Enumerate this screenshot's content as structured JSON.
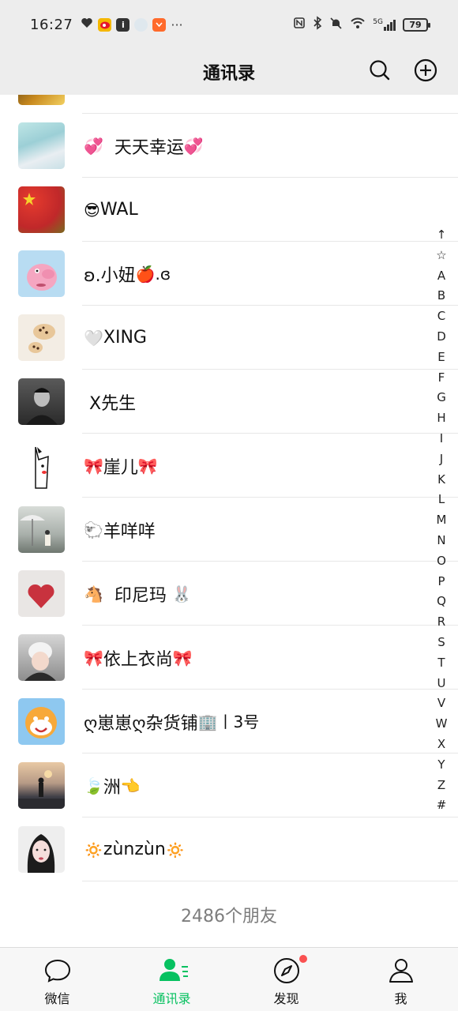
{
  "status": {
    "time": "16:27",
    "battery": "79",
    "net_label": "5G"
  },
  "header": {
    "title": "通讯录"
  },
  "contacts": [
    {
      "name": "天天幸运",
      "prefix_emoji": "💞",
      "suffix_emoji": "💞"
    },
    {
      "name": "WAL",
      "prefix_emoji": "😎",
      "suffix_emoji": ""
    },
    {
      "name": "ʚ.小妞",
      "prefix_emoji": "",
      "suffix_emoji": "🍎.ɞ"
    },
    {
      "name": "XING",
      "prefix_emoji": "🤍",
      "suffix_emoji": ""
    },
    {
      "name": "X先生",
      "prefix_emoji": "",
      "suffix_emoji": ""
    },
    {
      "name": "崖儿",
      "prefix_emoji": "🎀",
      "suffix_emoji": "🎀"
    },
    {
      "name": "羊咩咩",
      "prefix_emoji": "🐑",
      "suffix_emoji": ""
    },
    {
      "name": "印尼玛",
      "prefix_emoji": "🐴",
      "suffix_emoji": "🐰"
    },
    {
      "name": "依上衣尚",
      "prefix_emoji": "🎀",
      "suffix_emoji": "🎀"
    },
    {
      "name": "ღ崽崽ღ杂货铺",
      "prefix_emoji": "",
      "suffix_emoji": "🏢丨3号"
    },
    {
      "name": "洲",
      "prefix_emoji": "🍃",
      "suffix_emoji": "👈"
    },
    {
      "name": "zùnzùn",
      "prefix_emoji": "🔅",
      "suffix_emoji": "🔅"
    }
  ],
  "friend_count": "2486个朋友",
  "index_letters": [
    "↑",
    "☆",
    "A",
    "B",
    "C",
    "D",
    "E",
    "F",
    "G",
    "H",
    "I",
    "J",
    "K",
    "L",
    "M",
    "N",
    "O",
    "P",
    "Q",
    "R",
    "S",
    "T",
    "U",
    "V",
    "W",
    "X",
    "Y",
    "Z",
    "#"
  ],
  "tabs": [
    {
      "label": "微信",
      "icon": "chat-bubble-icon",
      "active": false
    },
    {
      "label": "通讯录",
      "icon": "contacts-icon",
      "active": true
    },
    {
      "label": "发现",
      "icon": "compass-icon",
      "active": false,
      "badge": true
    },
    {
      "label": "我",
      "icon": "person-icon",
      "active": false
    }
  ],
  "colors": {
    "accent": "#07c160",
    "header_bg": "#ededed",
    "badge": "#fa5151"
  }
}
